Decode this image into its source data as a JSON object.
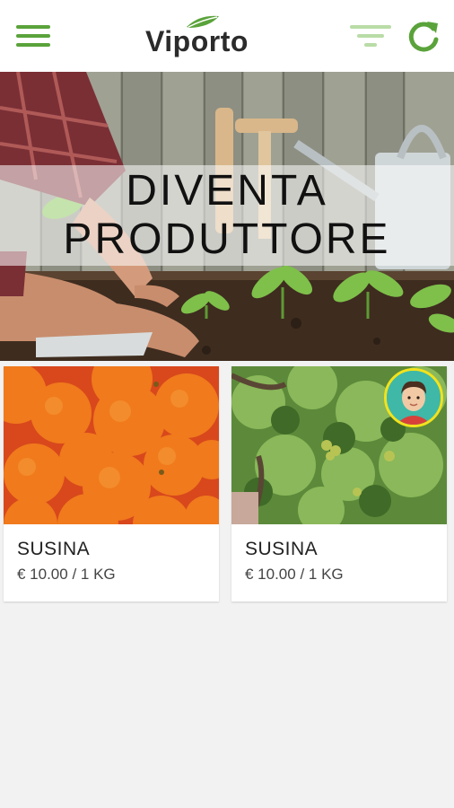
{
  "app": {
    "logo_text": "Viporto",
    "accent_color": "#5aa33b"
  },
  "toolbar": {
    "menu_icon": "hamburger-menu-icon",
    "filter_icon": "filter-icon",
    "refresh_icon": "refresh-icon"
  },
  "banner": {
    "title_line1": "DIVENTA",
    "title_line2": "PRODUTTORE"
  },
  "products": [
    {
      "name": "SUSINA",
      "price": "€ 10.00 / 1 KG",
      "image": "oranges"
    },
    {
      "name": "SUSINA",
      "price": "€ 10.00 / 1 KG",
      "image": "fruit-tree",
      "has_producer_avatar": true
    }
  ]
}
